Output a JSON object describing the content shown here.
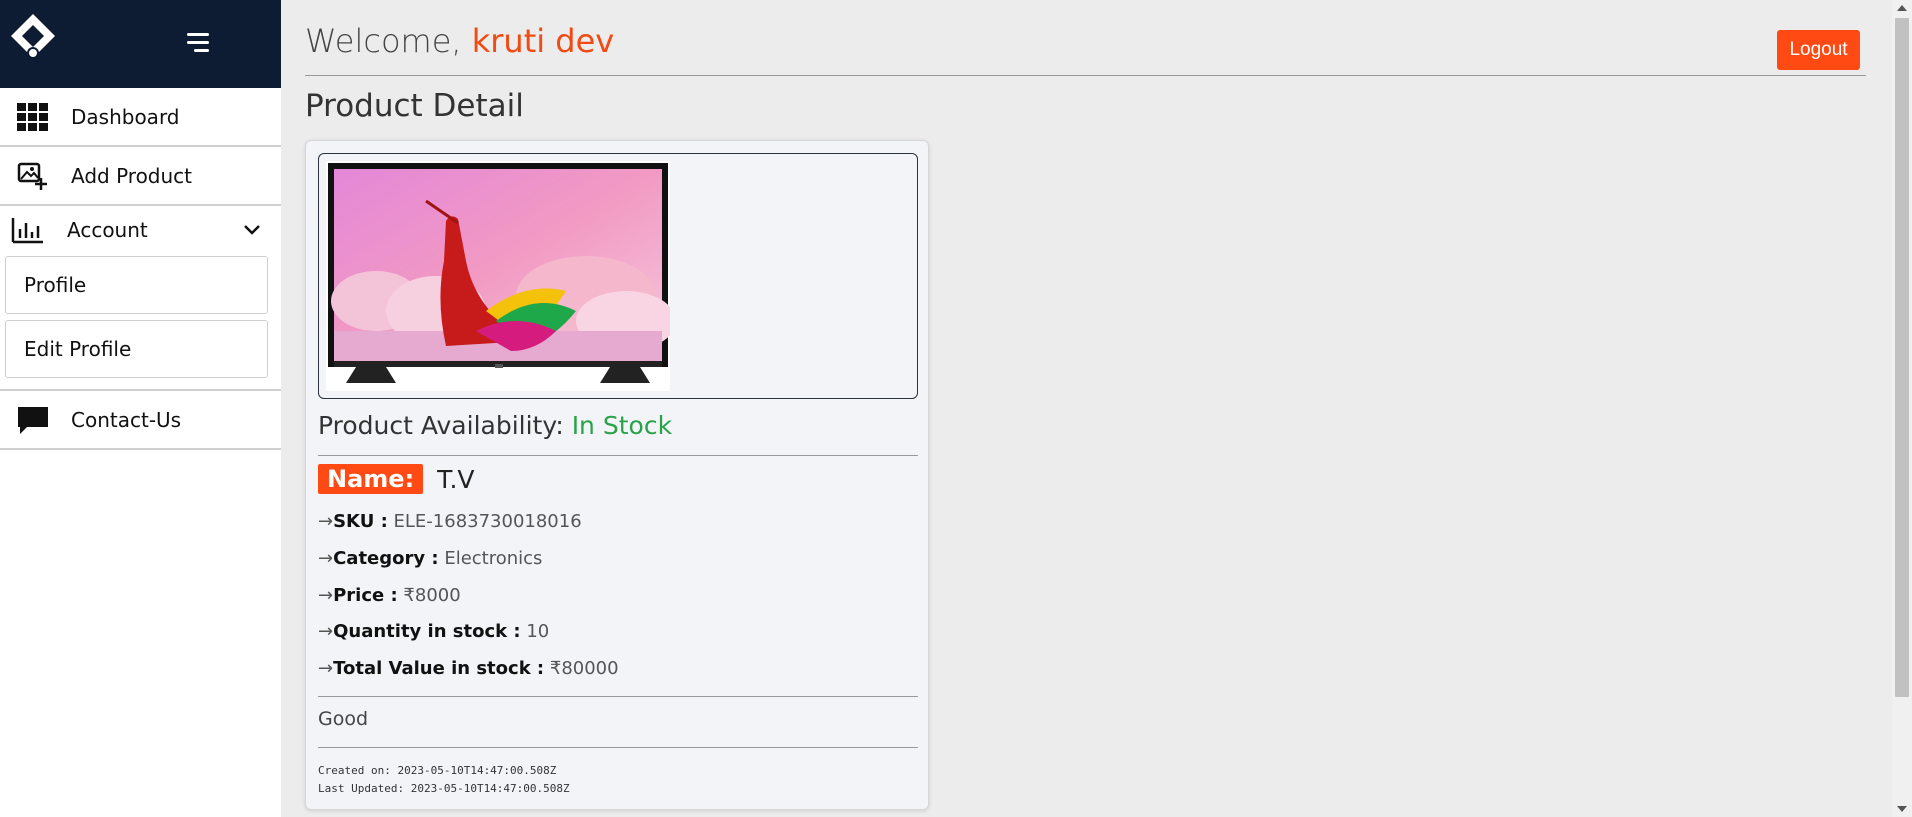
{
  "header": {
    "welcome_prefix": "Welcome, ",
    "username": "kruti dev",
    "logout_label": "Logout"
  },
  "sidebar": {
    "items": [
      {
        "label": "Dashboard",
        "icon": "grid-icon"
      },
      {
        "label": "Add Product",
        "icon": "add-image-icon"
      },
      {
        "label": "Account",
        "icon": "bar-chart-icon",
        "expanded": true,
        "children": [
          {
            "label": "Profile"
          },
          {
            "label": "Edit Profile"
          }
        ]
      },
      {
        "label": "Contact-Us",
        "icon": "chat-bubble-icon"
      }
    ]
  },
  "page": {
    "title": "Product Detail"
  },
  "product": {
    "availability_label": "Product Availability: ",
    "availability_value": "In Stock",
    "name_label": "Name:",
    "name": "T.V",
    "fields": [
      {
        "arrow": "→",
        "label": "SKU :",
        "value": "ELE-1683730018016"
      },
      {
        "arrow": "→",
        "label": "Category :",
        "value": "Electronics"
      },
      {
        "arrow": "→",
        "label": "Price :",
        "value": "₹8000"
      },
      {
        "arrow": "→",
        "label": "Quantity in stock :",
        "value": "10"
      },
      {
        "arrow": "→",
        "label": "Total Value in stock :",
        "value": "₹80000"
      }
    ],
    "description": "Good",
    "created": "Created on: 2023-05-10T14:47:00.508Z",
    "updated": "Last Updated: 2023-05-10T14:47:00.508Z"
  },
  "colors": {
    "sidebar_header": "#0e1c33",
    "accent": "#ff4a14",
    "in_stock": "#2aa24a"
  }
}
